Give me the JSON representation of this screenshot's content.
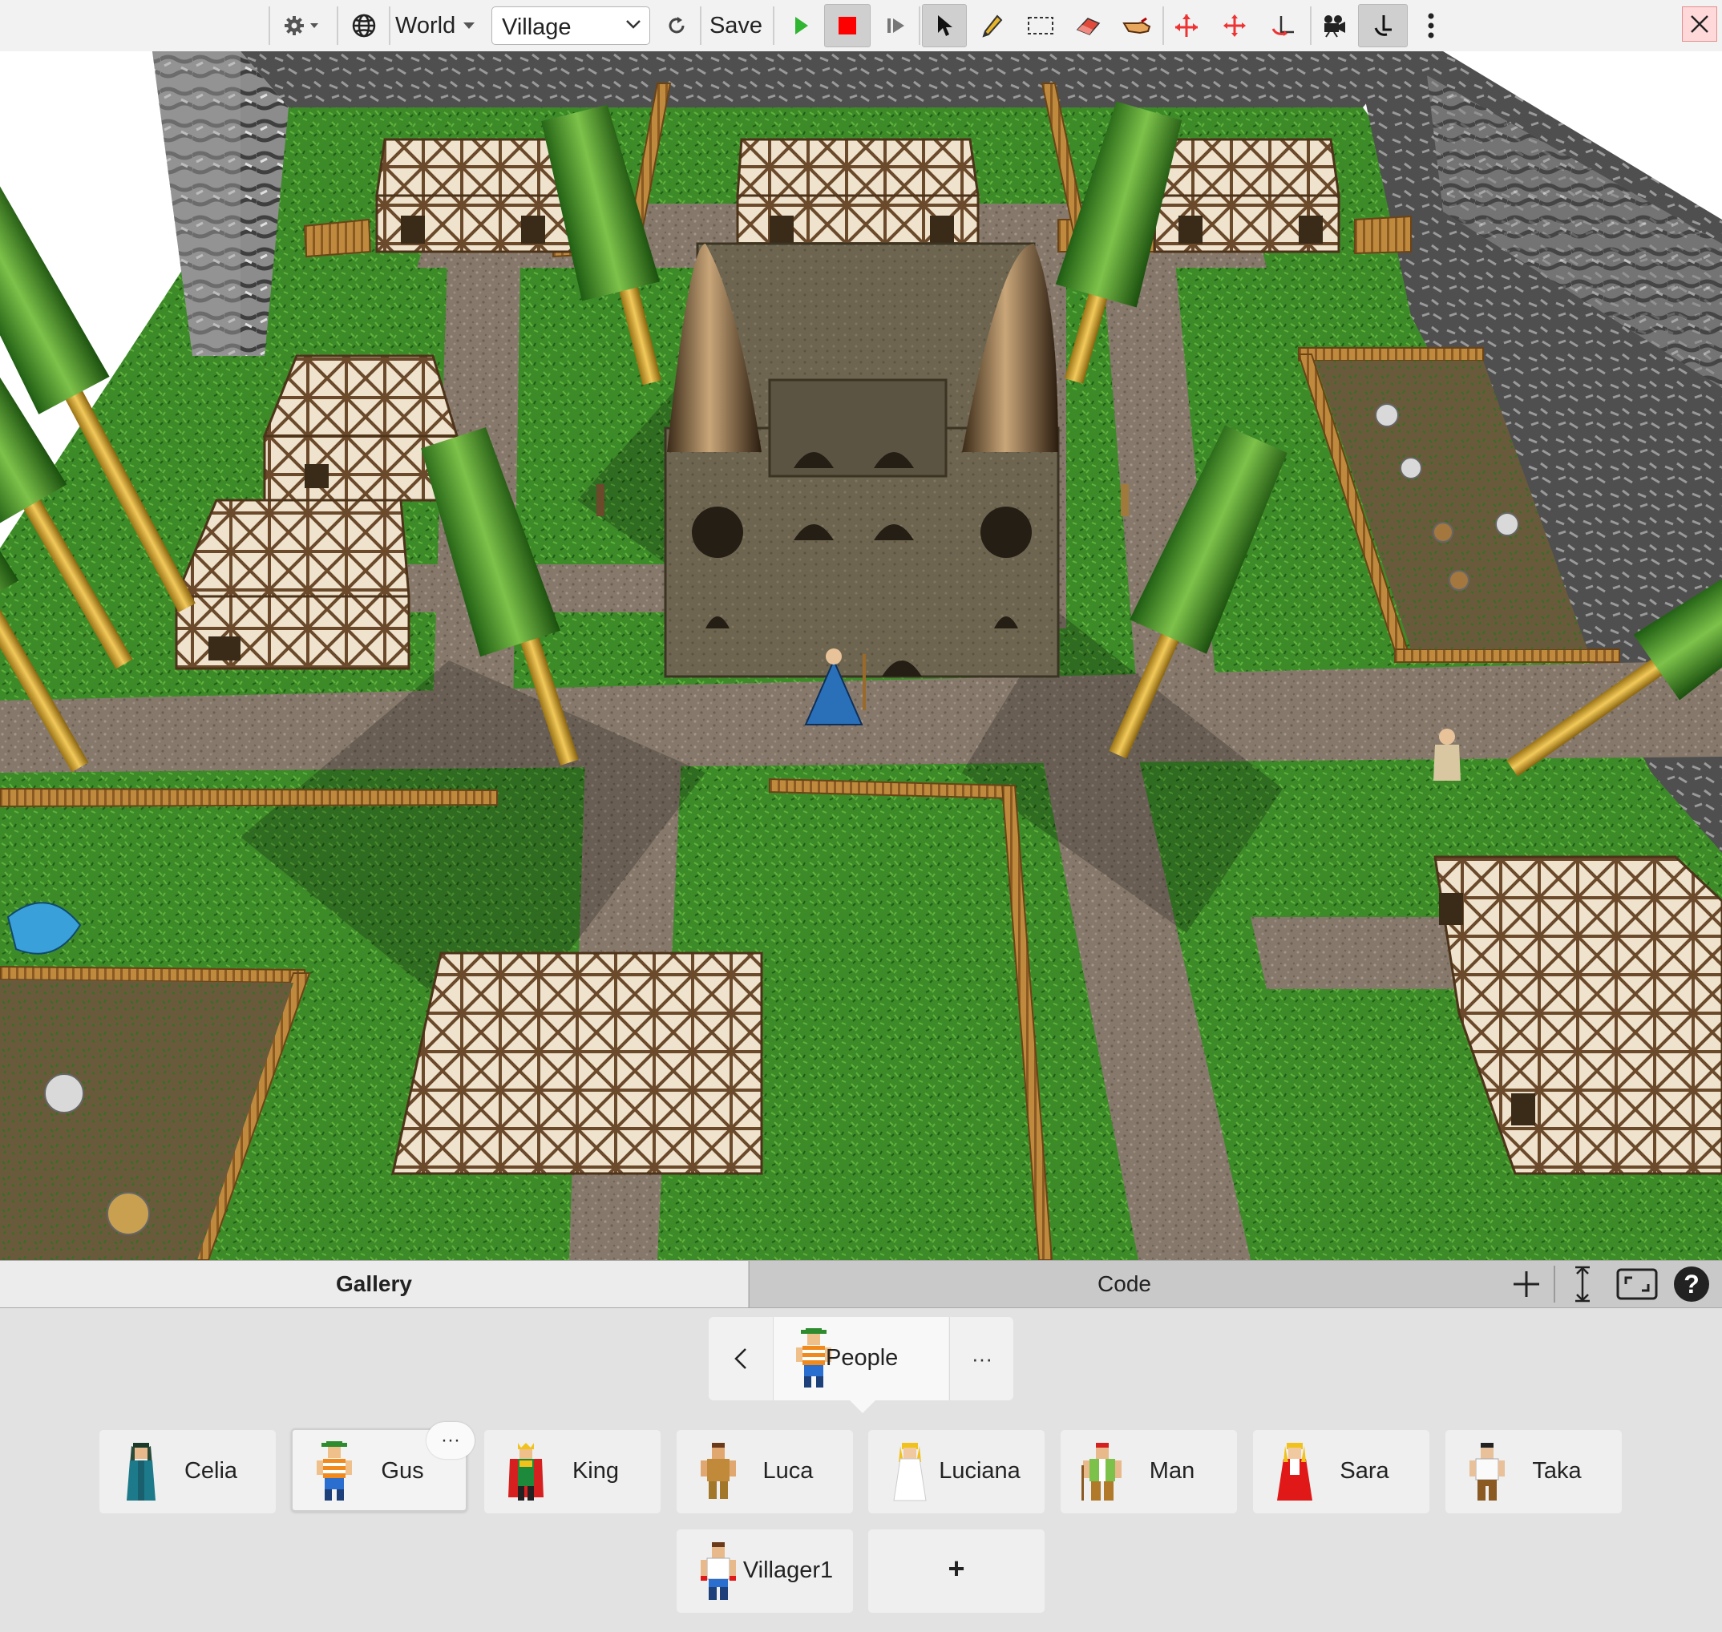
{
  "toolbar": {
    "settings_icon": "gear-icon",
    "world_menu_label": "World",
    "world_select_value": "Village",
    "save_label": "Save",
    "tools": [
      "play-icon",
      "stop-icon",
      "step-icon",
      "pointer-icon",
      "pencil-icon",
      "select-rect-icon",
      "eraser-icon",
      "grab-hand-icon",
      "move-ground-icon",
      "move-icon",
      "rotate-icon",
      "camera-icon",
      "walk-icon",
      "more-icon"
    ]
  },
  "world": {
    "name": "Village"
  },
  "tabs": {
    "gallery_label": "Gallery",
    "code_label": "Code",
    "active": "Gallery"
  },
  "gallery": {
    "breadcrumb_label": "People",
    "breadcrumb_more": "···",
    "card_more": "···",
    "characters": [
      {
        "name": "Celia"
      },
      {
        "name": "Gus"
      },
      {
        "name": "King"
      },
      {
        "name": "Luca"
      },
      {
        "name": "Luciana"
      },
      {
        "name": "Man"
      },
      {
        "name": "Sara"
      },
      {
        "name": "Taka"
      },
      {
        "name": "Villager1"
      }
    ],
    "selected": "Gus",
    "add_label": "+"
  },
  "colors": {
    "grass": "#3f8a2a",
    "path": "#8a7d70",
    "stop": "#ff0000",
    "play": "#2fb52f"
  }
}
